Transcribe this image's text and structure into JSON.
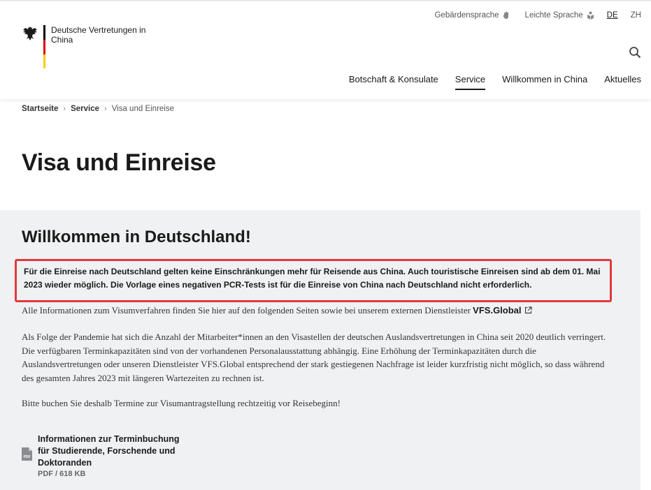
{
  "header": {
    "logo_text": "Deutsche Vertretungen in China",
    "meta": {
      "sign_language": "Gebärdensprache",
      "easy_language": "Leichte Sprache",
      "lang_de": "DE",
      "lang_zh": "ZH"
    },
    "nav": [
      {
        "label": "Botschaft & Konsulate"
      },
      {
        "label": "Service"
      },
      {
        "label": "Willkommen in China"
      },
      {
        "label": "Aktuelles"
      }
    ]
  },
  "breadcrumb": {
    "home": "Startseite",
    "service": "Service",
    "current": "Visa und Einreise",
    "separator": "›"
  },
  "page": {
    "title": "Visa und Einreise"
  },
  "panel": {
    "title": "Willkommen in Deutschland!",
    "highlight": "Für die Einreise nach Deutschland gelten keine Einschränkungen mehr für Reisende aus China. Auch touristische Einreisen sind ab dem 01. Mai 2023 wieder möglich. Die Vorlage eines negativen PCR-Tests ist für die Einreise von China nach Deutschland nicht erforderlich.",
    "para1_text": "Alle Informationen zum Visumverfahren finden Sie hier auf den folgenden Seiten sowie bei unserem externen Dienstleister ",
    "para1_link": "VFS.Global",
    "para2": "Als Folge der Pandemie hat sich die Anzahl der Mitarbeiter*innen an den Visastellen der deutschen Auslandsvertretungen in China seit 2020 deutlich verringert. Die verfügbaren Terminkapazitäten sind von der vorhandenen Personalausstattung abhängig. Eine Erhöhung der Terminkapazitäten durch die Auslandsvertretungen oder unseren Dienstleister VFS.Global entsprechend der stark gestiegenen Nachfrage ist leider kurzfristig nicht möglich, so dass während des gesamten Jahres 2023 mit längeren Wartezeiten zu rechnen ist.",
    "para3": "Bitte buchen Sie deshalb Termine zur Visumantragstellung rechtzeitig vor Reisebeginn!",
    "download": {
      "title": "Informationen zur Terminbuchung für Studierende, Forschende und Doktoranden",
      "meta": "PDF / 618 KB",
      "icon_label": "PDF"
    }
  },
  "icons": {
    "eagle": "federal-eagle-icon",
    "sign_language": "hand-icon",
    "easy_language": "easy-language-icon",
    "search": "search-icon",
    "external": "external-link-icon",
    "pdf": "pdf-file-icon"
  },
  "colors": {
    "highlight_border": "#e03a3e",
    "panel_bg": "#f0f1f2",
    "flag_black": "#000000",
    "flag_red": "#dd0000",
    "flag_gold": "#ffcc00"
  }
}
